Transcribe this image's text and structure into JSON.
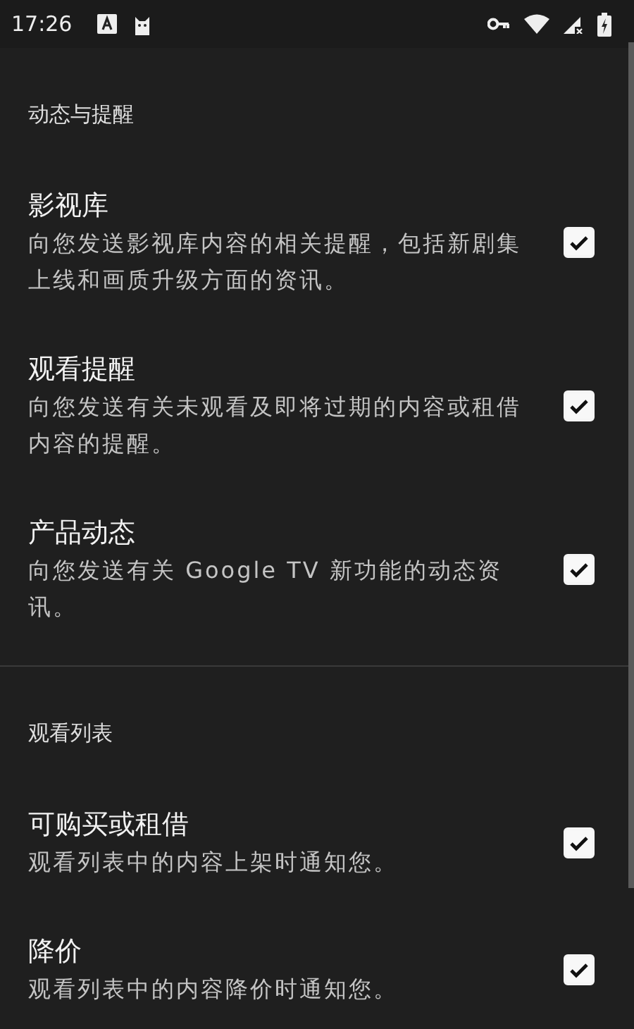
{
  "status_bar": {
    "time": "17:26"
  },
  "sections": [
    {
      "header": "动态与提醒",
      "items": [
        {
          "title": "影视库",
          "description": "向您发送影视库内容的相关提醒，包括新剧集上线和画质升级方面的资讯。",
          "checked": true
        },
        {
          "title": "观看提醒",
          "description": "向您发送有关未观看及即将过期的内容或租借内容的提醒。",
          "checked": true
        },
        {
          "title": "产品动态",
          "description": "向您发送有关 Google TV 新功能的动态资讯。",
          "checked": true
        }
      ]
    },
    {
      "header": "观看列表",
      "items": [
        {
          "title": "可购买或租借",
          "description": "观看列表中的内容上架时通知您。",
          "checked": true
        },
        {
          "title": "降价",
          "description": "观看列表中的内容降价时通知您。",
          "checked": true
        }
      ]
    }
  ]
}
